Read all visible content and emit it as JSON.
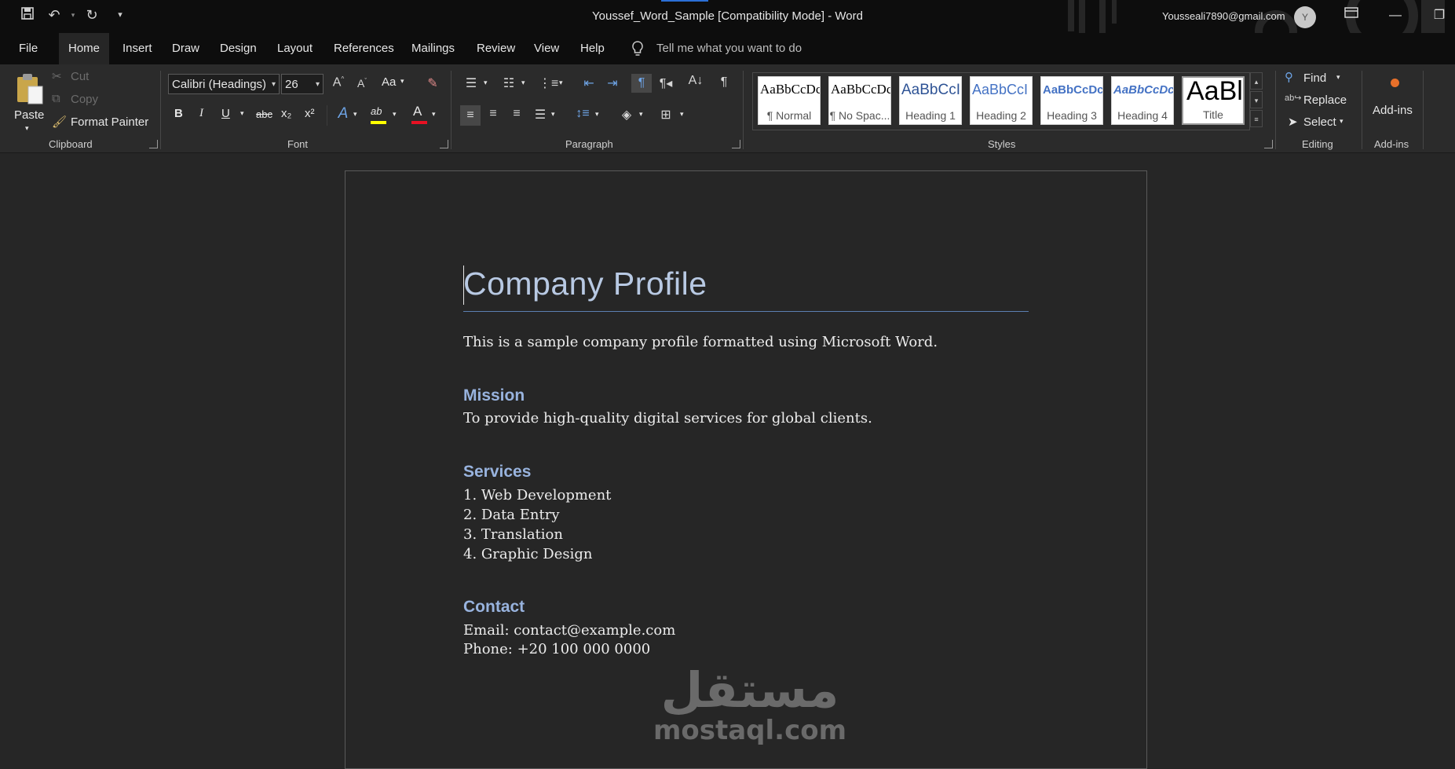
{
  "titlebar": {
    "document_title": "Youssef_Word_Sample [Compatibility Mode]  -  Word",
    "user_email": "Yousseali7890@gmail.com",
    "avatar_initial": "Y"
  },
  "menu": {
    "tabs": [
      "File",
      "Home",
      "Insert",
      "Draw",
      "Design",
      "Layout",
      "References",
      "Mailings",
      "Review",
      "View",
      "Help"
    ],
    "active_tab": "Home",
    "tell_me_placeholder": "Tell me what you want to do"
  },
  "ribbon": {
    "clipboard": {
      "paste": "Paste",
      "cut": "Cut",
      "copy": "Copy",
      "format_painter": "Format Painter",
      "label": "Clipboard"
    },
    "font": {
      "family": "Calibri (Headings)",
      "size": "26",
      "change_case": "Aa",
      "bold": "B",
      "italic": "I",
      "underline": "U",
      "strikethrough": "abc",
      "subscript": "x₂",
      "superscript": "x²",
      "highlight_glyph": "ab",
      "font_color_glyph": "A",
      "label": "Font"
    },
    "paragraph": {
      "label": "Paragraph"
    },
    "styles": {
      "items": [
        {
          "sample": "AaBbCcDc",
          "name": "¶ Normal"
        },
        {
          "sample": "AaBbCcDc",
          "name": "¶ No Spac..."
        },
        {
          "sample": "AaBbCcI",
          "name": "Heading 1"
        },
        {
          "sample": "AaBbCcI",
          "name": "Heading 2"
        },
        {
          "sample": "AaBbCcDc",
          "name": "Heading 3"
        },
        {
          "sample": "AaBbCcDc",
          "name": "Heading 4"
        },
        {
          "sample": "AaBl",
          "name": "Title"
        }
      ],
      "label": "Styles"
    },
    "editing": {
      "find": "Find",
      "replace": "Replace",
      "select": "Select",
      "label": "Editing"
    },
    "addins": {
      "button": "Add-ins",
      "label": "Add-ins"
    }
  },
  "document": {
    "title": "Company Profile",
    "intro": "This is a sample company profile formatted using Microsoft Word.",
    "mission_heading": "Mission",
    "mission_text": "To provide high-quality digital services for global clients.",
    "services_heading": "Services",
    "services": [
      "1. Web Development",
      "2. Data Entry",
      "3. Translation",
      "4. Graphic Design"
    ],
    "contact_heading": "Contact",
    "contact_email": "Email: contact@example.com",
    "contact_phone": "Phone: +20 100 000 0000"
  },
  "watermark": {
    "arabic": "مستقل",
    "latin": "mostaql.com"
  },
  "colors": {
    "title": "#b8c9e3",
    "heading": "#98b3de",
    "rule": "#5b7fb0",
    "accent": "#2b6fd6"
  }
}
